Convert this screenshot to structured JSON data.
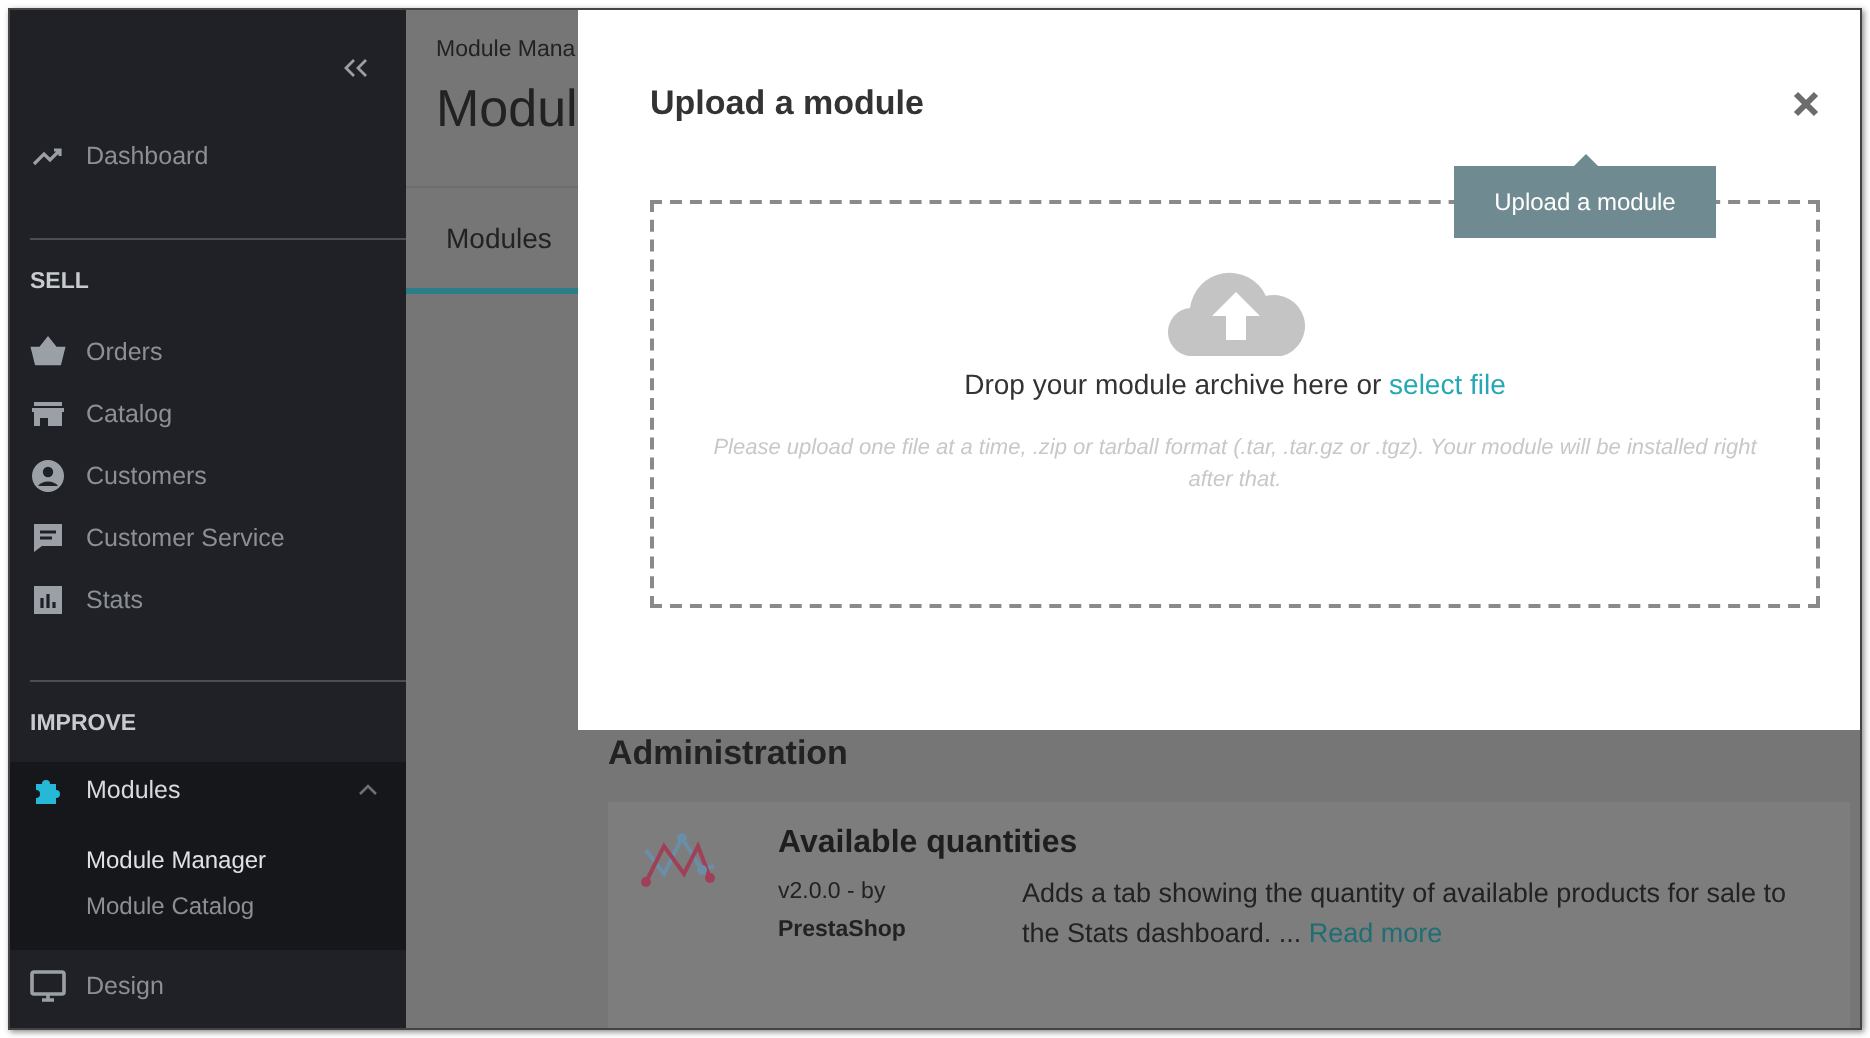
{
  "sidebar": {
    "sections": [
      {
        "items": [
          {
            "label": "Dashboard"
          }
        ]
      },
      {
        "title": "SELL",
        "items": [
          {
            "label": "Orders"
          },
          {
            "label": "Catalog"
          },
          {
            "label": "Customers"
          },
          {
            "label": "Customer Service"
          },
          {
            "label": "Stats"
          }
        ]
      },
      {
        "title": "IMPROVE",
        "items": [
          {
            "label": "Modules",
            "selected": true,
            "expanded": true,
            "children": [
              {
                "label": "Module Manager",
                "selected": true
              },
              {
                "label": "Module Catalog",
                "selected": false
              }
            ]
          },
          {
            "label": "Design"
          }
        ]
      }
    ]
  },
  "header": {
    "breadcrumb": "Module Mana",
    "title": "Modul",
    "tabs": [
      {
        "label": "Modules",
        "selected": true
      }
    ]
  },
  "section": {
    "heading": "Administration",
    "modules": [
      {
        "name": "Available quantities",
        "version": "v2.0.0 - by",
        "author": "PrestaShop",
        "description": "Adds a tab showing the quantity of available products for sale to the Stats dashboard. ...",
        "link": "Read more"
      }
    ]
  },
  "modal": {
    "title": "Upload a module",
    "tooltip": "Upload a module",
    "drop_text": "Drop your module archive here or",
    "select_link": "select file",
    "hint": "Please upload one file at a time, .zip or tarball format (.tar, .tar.gz or .tgz). Your module will be installed right after that."
  }
}
